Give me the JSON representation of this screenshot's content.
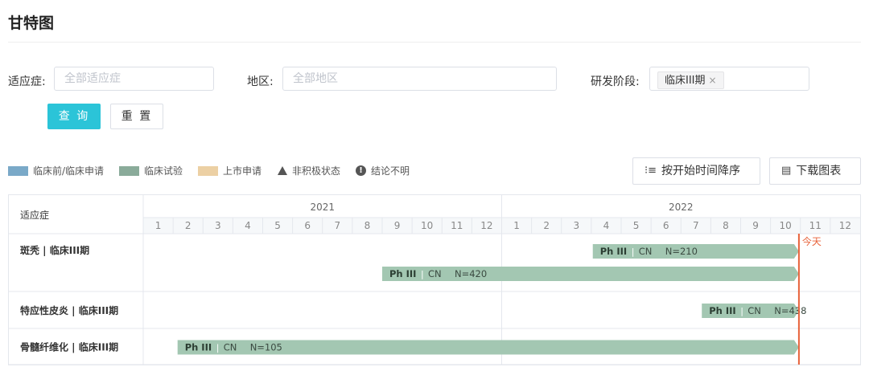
{
  "page": {
    "title": "甘特图"
  },
  "filters": {
    "indication": {
      "label": "适应症:",
      "placeholder": "全部适应症"
    },
    "region": {
      "label": "地区:",
      "placeholder": "全部地区"
    },
    "stage": {
      "label": "研发阶段:",
      "tag": "临床III期",
      "tag_close": "×"
    }
  },
  "buttons": {
    "query": "查 询",
    "reset": "重 置"
  },
  "legend": [
    {
      "label": "临床前/临床申请",
      "color": "#7aa9c8",
      "icon": "swatch"
    },
    {
      "label": "临床试验",
      "color": "#8aab9a",
      "icon": "swatch"
    },
    {
      "label": "上市申请",
      "color": "#ecd0a4",
      "icon": "swatch"
    },
    {
      "label": "非积极状态",
      "icon": "triangle-icon"
    },
    {
      "label": "结论不明",
      "icon": "info-icon"
    }
  ],
  "toolbar": {
    "sort": {
      "label": "按开始时间降序",
      "icon": "sort-icon"
    },
    "download": {
      "label": "下载图表",
      "icon": "document-icon"
    }
  },
  "gantt": {
    "column_header": "适应症",
    "years": [
      "2021",
      "2022"
    ],
    "months": [
      1,
      2,
      3,
      4,
      5,
      6,
      7,
      8,
      9,
      10,
      11,
      12
    ],
    "today": {
      "label": "今天",
      "month": 21.95
    },
    "bar_color": "#a3c7b2",
    "today_color": "#e8623a",
    "rows": [
      {
        "label": "斑秃 | 临床III期",
        "bars": [
          {
            "start": 15.05,
            "end": 21.95,
            "phase": "Ph III",
            "sep": "|",
            "region": "CN",
            "n": "N=210"
          },
          {
            "start": 8.0,
            "end": 21.95,
            "phase": "Ph III",
            "sep": "|",
            "region": "CN",
            "n": "N=420"
          }
        ]
      },
      {
        "label": "特应性皮炎 | 临床III期",
        "bars": [
          {
            "start": 18.7,
            "end": 21.95,
            "phase": "Ph III",
            "sep": "|",
            "region": "CN",
            "n": "N=438"
          }
        ]
      },
      {
        "label": "骨髓纤维化 | 临床III期",
        "bars": [
          {
            "start": 1.15,
            "end": 21.95,
            "phase": "Ph III",
            "sep": "|",
            "region": "CN",
            "n": "N=105"
          }
        ]
      }
    ]
  }
}
